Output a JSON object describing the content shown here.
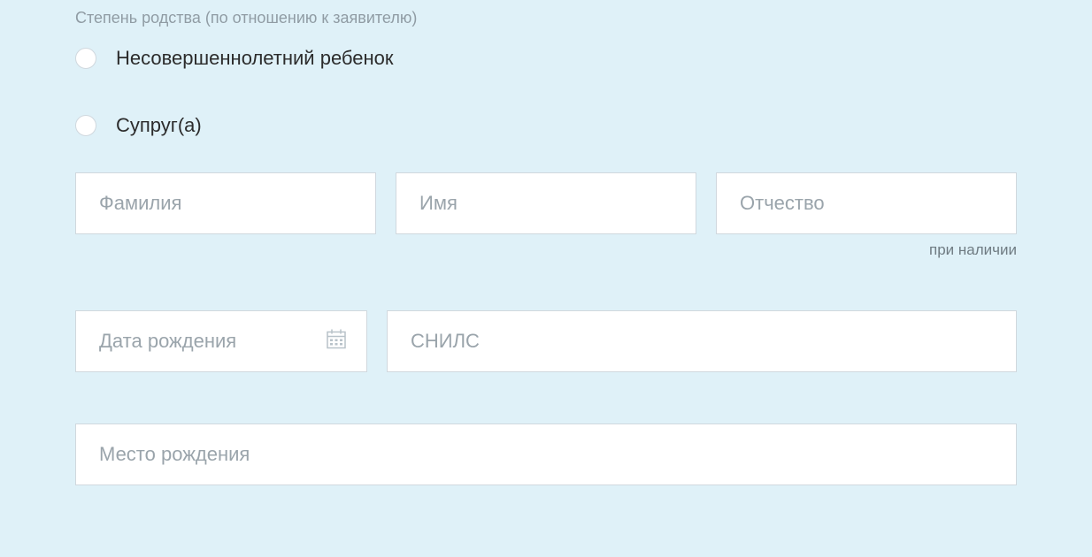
{
  "section": {
    "relationship_label": "Степень родства (по отношению к заявителю)"
  },
  "radio": {
    "minor_child": "Несовершеннолетний ребенок",
    "spouse": "Супруг(а)"
  },
  "fields": {
    "surname_placeholder": "Фамилия",
    "firstname_placeholder": "Имя",
    "patronymic_placeholder": "Отчество",
    "patronymic_hint": "при наличии",
    "birthdate_placeholder": "Дата рождения",
    "snils_placeholder": "СНИЛС",
    "birthplace_placeholder": "Место рождения"
  }
}
